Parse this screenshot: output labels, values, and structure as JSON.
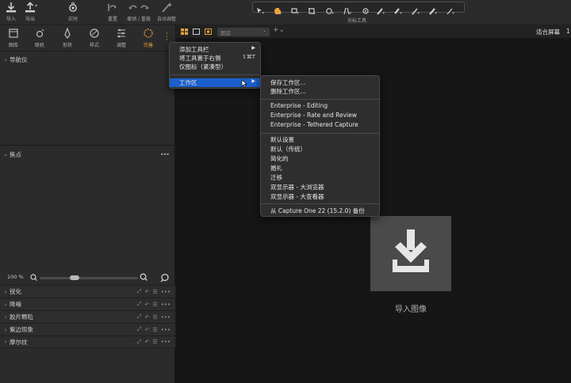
{
  "toolbar": {
    "import_label": "导入",
    "export_label": "导出",
    "tethered_label": "实时",
    "reset_label": "重置",
    "undo_redo_label": "撤销 / 重做",
    "auto_adjust_label": "自动调整",
    "cursor_tools_label": "光标工具"
  },
  "tool_tabs": [
    {
      "label": "图库",
      "icon": "library-icon"
    },
    {
      "label": "联机",
      "icon": "camera-icon"
    },
    {
      "label": "形状",
      "icon": "shape-icon"
    },
    {
      "label": "样式",
      "icon": "style-icon"
    },
    {
      "label": "调整",
      "icon": "sliders-icon"
    },
    {
      "label": "完善",
      "icon": "refine-icon"
    }
  ],
  "left_panel": {
    "navigator_title": "导航仪",
    "focus_title": "焦点",
    "zoom_value": "100 %",
    "tool_rows": [
      {
        "title": "锐化"
      },
      {
        "title": "降噪"
      },
      {
        "title": "胶片颗粒"
      },
      {
        "title": "紫边现象"
      },
      {
        "title": "摩尔纹"
      }
    ]
  },
  "viewer": {
    "view_select_value": "图层",
    "fit_label": "适合屏幕",
    "fit_extra": "1",
    "import_label": "导入图像"
  },
  "context_menu": {
    "items": [
      {
        "label": "添加工具栏",
        "has_submenu": true
      },
      {
        "label": "将工具置于右侧",
        "shortcut": "⇧⌘T"
      },
      {
        "label": "仅图标（紧凑型）"
      },
      {
        "label": "工作区",
        "has_submenu": true,
        "highlighted": true
      }
    ]
  },
  "workspace_menu": {
    "group1": [
      "保存工作区...",
      "删除工作区..."
    ],
    "group2": [
      "Enterprise - Editing",
      "Enterprise - Rate and Review",
      "Enterprise - Tethered Capture"
    ],
    "group3": [
      "默认设置",
      "默认（传统）",
      "简化的",
      "婚礼",
      "迁移",
      "双显示器 - 大浏览器",
      "双显示器 - 大查看器"
    ],
    "group4": [
      "从 Capture One 22 (15.2.0) 备份"
    ]
  },
  "colors": {
    "accent_active_tab": "#e8a33c",
    "menu_highlight": "#1a5fcc"
  }
}
